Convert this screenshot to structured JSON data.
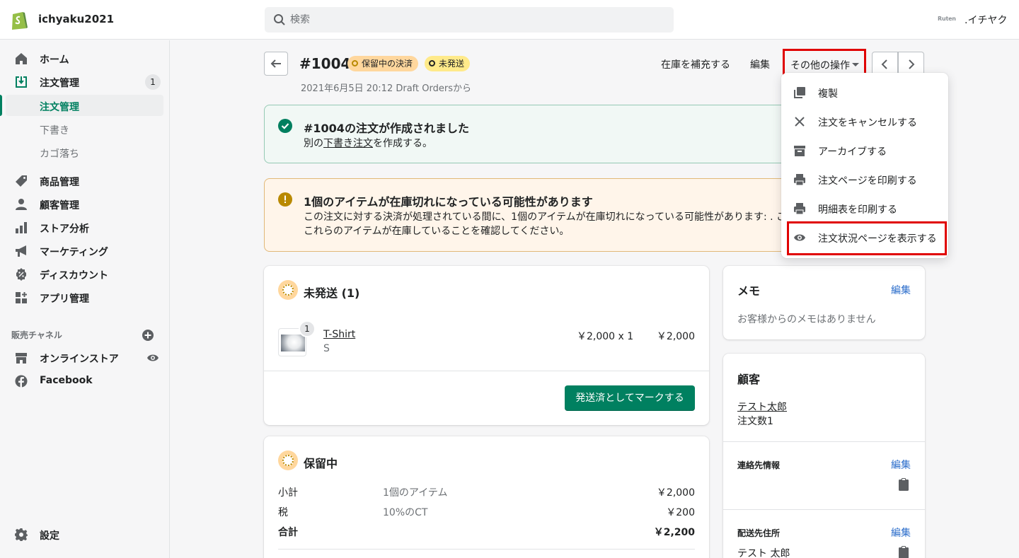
{
  "topbar": {
    "store_name": "ichyaku2021",
    "search_placeholder": "検索",
    "account_logo_text": "Ruten",
    "account_name": ".イチヤク"
  },
  "sidebar": {
    "home": "ホーム",
    "orders": "注文管理",
    "orders_count": "1",
    "orders_sub": [
      "注文管理",
      "下書き",
      "カゴ落ち"
    ],
    "products": "商品管理",
    "customers": "顧客管理",
    "analytics": "ストア分析",
    "marketing": "マーケティング",
    "discounts": "ディスカウント",
    "apps": "アプリ管理",
    "channels_heading": "販売チャネル",
    "online_store": "オンラインストア",
    "facebook": "Facebook",
    "settings": "設定"
  },
  "header": {
    "order_number": "#1004",
    "payment_badge": "保留中の決済",
    "fulfillment_badge": "未発送",
    "subtitle": "2021年6月5日 20:12 Draft Ordersから",
    "restock": "在庫を補充する",
    "edit": "編集",
    "more_actions": "その他の操作"
  },
  "success_banner": {
    "title": "#1004の注文が作成されました",
    "body_prefix": "別の",
    "body_link": "下書き注文",
    "body_suffix": "を作成する。"
  },
  "warning_banner": {
    "title": "1個のアイテムが在庫切れになっている可能性があります",
    "line1": "この注文に対する決済が処理されている間に、1個のアイテムが在庫切れになっている可能性があります: . こ",
    "line2": "これらのアイテムが在庫していることを確認してください。"
  },
  "unfulfilled_card": {
    "title": "未発送 (1)",
    "item_qty_badge": "1",
    "item_name": "T-Shirt",
    "item_variant": "S",
    "item_price_qty": "￥2,000 x 1",
    "item_total": "￥2,000",
    "mark_button": "発送済としてマークする"
  },
  "pending_card": {
    "title": "保留中",
    "rows": [
      {
        "label": "小計",
        "desc": "1個のアイテム",
        "amount": "￥2,000"
      },
      {
        "label": "税",
        "desc": "10%のCT",
        "amount": "￥200"
      },
      {
        "label": "合計",
        "desc": "",
        "amount": "￥2,200"
      }
    ]
  },
  "memo_card": {
    "title": "メモ",
    "edit": "編集",
    "empty": "お客様からのメモはありません"
  },
  "customer_card": {
    "title": "顧客",
    "name": "テスト太郎",
    "orders": "注文数1",
    "contact_heading": "連絡先情報",
    "contact_edit": "編集",
    "shipping_heading": "配送先住所",
    "shipping_edit": "編集",
    "shipping_name": "テスト 太郎"
  },
  "more_menu": {
    "items": [
      {
        "label": "複製",
        "icon": "duplicate-icon"
      },
      {
        "label": "注文をキャンセルする",
        "icon": "close-icon"
      },
      {
        "label": "アーカイブする",
        "icon": "archive-icon"
      },
      {
        "label": "注文ページを印刷する",
        "icon": "print-icon"
      },
      {
        "label": "明細表を印刷する",
        "icon": "print-icon"
      },
      {
        "label": "注文状況ページを表示する",
        "icon": "eye-icon"
      }
    ]
  },
  "colors": {
    "brand_green": "#008060",
    "highlight_red": "#e00000",
    "link_blue": "#2c6ecb"
  }
}
